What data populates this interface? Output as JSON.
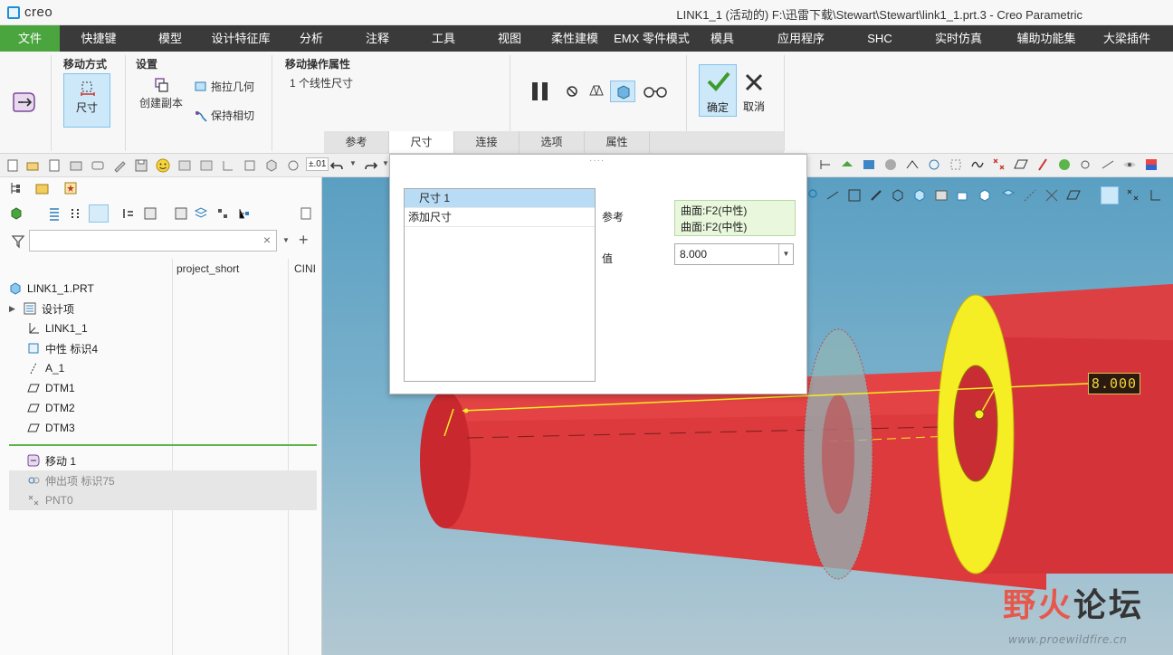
{
  "app": {
    "brand": "creo",
    "title": "LINK1_1 (活动的) F:\\迅雷下载\\Stewart\\Stewart\\link1_1.prt.3 - Creo Parametric"
  },
  "menu": [
    "文件",
    "快捷键",
    "模型",
    "设计特征库",
    "分析",
    "注释",
    "工具",
    "视图",
    "柔性建模",
    "EMX 零件模式",
    "模具",
    "应用程序",
    "SHC",
    "实时仿真",
    "辅助功能集",
    "大梁插件"
  ],
  "ribbon": {
    "move_method_label": "移动方式",
    "dim_button": "尺寸",
    "settings_label": "设置",
    "create_copy": "创建副本",
    "drag_geometry": "拖拉几何",
    "keep_tangent": "保持相切",
    "props_label": "移动操作属性",
    "props_value": "1 个线性尺寸",
    "ok": "确定",
    "cancel": "取消",
    "tabs": [
      "参考",
      "尺寸",
      "连接",
      "选项",
      "属性"
    ]
  },
  "toolbar": {
    "precision": "±.01"
  },
  "left_panel": {
    "columns": [
      "project_short",
      "CINI"
    ],
    "tree": [
      {
        "label": "LINK1_1.PRT",
        "icon": "part-icon"
      },
      {
        "label": "设计项",
        "icon": "design-items-icon"
      },
      {
        "label": "LINK1_1",
        "icon": "csys-icon"
      },
      {
        "label": "中性 标识4",
        "icon": "neutral-feature-icon"
      },
      {
        "label": "A_1",
        "icon": "axis-icon"
      },
      {
        "label": "DTM1",
        "icon": "datum-plane-icon"
      },
      {
        "label": "DTM2",
        "icon": "datum-plane-icon"
      },
      {
        "label": "DTM3",
        "icon": "datum-plane-icon"
      },
      {
        "label": "移动 1",
        "icon": "move-feature-icon"
      },
      {
        "label": "伸出项 标识75",
        "icon": "extrude-icon"
      },
      {
        "label": "PNT0",
        "icon": "datum-point-icon"
      }
    ]
  },
  "dialog": {
    "items": [
      "尺寸 1",
      "添加尺寸"
    ],
    "ref_label": "参考",
    "refs": [
      "曲面:F2(中性)",
      "曲面:F2(中性)"
    ],
    "value_label": "值",
    "value": "8.000"
  },
  "viewport": {
    "dimension_label": "8.000"
  },
  "watermark": {
    "text_a": "野火",
    "text_b": "论坛",
    "url": "www.proewildfire.cn"
  },
  "colors": {
    "menu_active": "#4aa53e",
    "part_red": "#d8323a",
    "highlight": "#f5ee24"
  }
}
